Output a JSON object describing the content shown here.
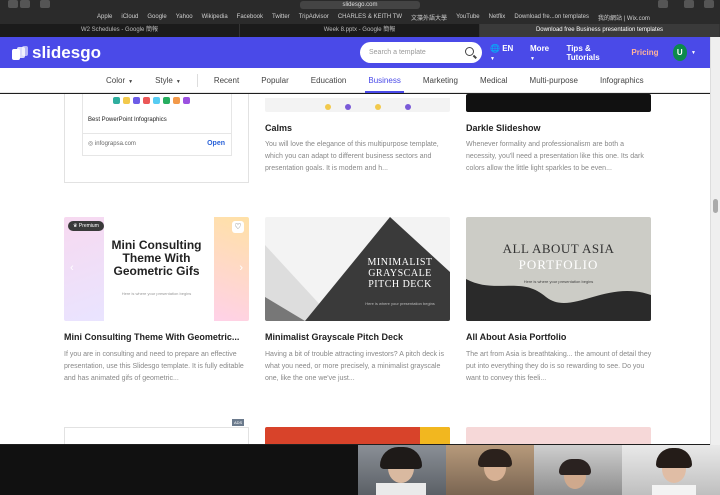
{
  "browser": {
    "url": "slidesgo.com",
    "bookmarks": [
      "Apple",
      "iCloud",
      "Google",
      "Yahoo",
      "Wikipedia",
      "Facebook",
      "Twitter",
      "TripAdvisor",
      "CHARLES & KEITH TW",
      "文藻外語大學",
      "YouTube",
      "Netflix",
      "Download fre...on templates",
      "我的網站 | Wix.com"
    ],
    "tabs": [
      "W2 Schedules - Google 簡報",
      "Week 8.pptx - Google 簡報",
      "Download free Business presentation templates"
    ]
  },
  "header": {
    "logo": "slidesgo",
    "search_placeholder": "Search a template",
    "language": "EN",
    "more": "More",
    "tips": "Tips & Tutorials",
    "pricing": "Pricing",
    "avatar_letter": "U"
  },
  "categories": [
    "Color",
    "Style",
    "Recent",
    "Popular",
    "Education",
    "Business",
    "Marketing",
    "Medical",
    "Multi-purpose",
    "Infographics"
  ],
  "ad": {
    "title": "Best PowerPoint Infographics",
    "url": "infograpsa.com",
    "open": "Open",
    "tag": "ADS"
  },
  "cards_top": [
    {
      "title": "Calms",
      "desc": "You will love the elegance of this multipurpose template, which you can adapt to different business sectors and presentation goals. It is modern and h..."
    },
    {
      "title": "Darkle Slideshow",
      "desc": "Whenever formality and professionalism are both a necessity, you'll need a presentation like this one. Its dark colors allow the little light sparkles to be even..."
    }
  ],
  "cards": [
    {
      "title": "Mini Consulting Theme With Geometric...",
      "desc": "If you are in consulting and need to prepare an effective presentation, use this Slidesgo template. It is fully editable and has animated gifs of geometric...",
      "thumb_line1": "Mini Consulting",
      "thumb_line2": "Theme With",
      "thumb_line3": "Geometric Gifs",
      "thumb_sub": "Here is where your presentation begins",
      "badge": "Premium"
    },
    {
      "title": "Minimalist Grayscale Pitch Deck",
      "desc": "Having a bit of trouble attracting investors? A pitch deck is what you need, or more precisely, a minimalist grayscale one, like the one we've just...",
      "thumb_line1": "MINIMALIST",
      "thumb_line2": "GRAYSCALE",
      "thumb_line3": "PITCH DECK",
      "thumb_sub": "Here is where your presentation begins"
    },
    {
      "title": "All About Asia Portfolio",
      "desc": "The art from Asia is breathtaking... the amount of detail they put into everything they do is so rewarding to see. Do you want to convey this feeli...",
      "thumb_line1": "ALL ABOUT ASIA",
      "thumb_line2": "PORTFOLIO",
      "thumb_sub": "Here is where your presentation begins"
    }
  ],
  "colors": {
    "brand": "#4a4ae8",
    "pricing": "#ffb39b",
    "avatar": "#0c8a4c"
  }
}
